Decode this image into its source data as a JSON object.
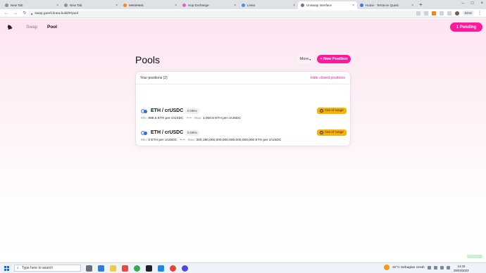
{
  "browser": {
    "tabs": [
      {
        "title": "New Tab",
        "active": false
      },
      {
        "title": "New Tab",
        "active": false
      },
      {
        "title": "MetaMask",
        "active": false
      },
      {
        "title": "Hop Exchange",
        "active": false
      },
      {
        "title": "Linea",
        "active": false
      },
      {
        "title": "Uniswap Interface",
        "active": true
      },
      {
        "title": "Home - Terracon Quest",
        "active": false
      }
    ],
    "url": "swap.goerli.linea.build/#/pool",
    "profile": "Error"
  },
  "app": {
    "nav": {
      "swap": "Swap",
      "pool": "Pool"
    },
    "pending_label": "1 Pending",
    "page_title": "Pools",
    "more_label": "More",
    "new_position_label": "+ New Position",
    "positions_header": "Your positions (2)",
    "hide_closed_label": "Hide closed positions",
    "positions": [
      {
        "pair": "ETH / crUSDC",
        "fee": "0.05%",
        "status": "Out of range",
        "min_label": "Min:",
        "min_value": "999.5 ETH per crUSDC",
        "max_label": "Max:",
        "max_value": "1,000.5 ETH per crUSDC"
      },
      {
        "pair": "ETH / crUSDC",
        "fee": "0.05%",
        "status": "Out of range",
        "min_label": "Min:",
        "min_value": "0 ETH per crUSDC",
        "max_label": "Max:",
        "max_value": "340,190,000,000,000,000,000,000,000 ETH per crUSDC"
      }
    ]
  },
  "taskbar": {
    "search_placeholder": "Type here to search",
    "weather": "31°C  Sebagian cerah",
    "time": "14:33",
    "date": "29/03/2023"
  },
  "colors": {
    "accent": "#fc1a9c",
    "warning": "#f6b20a"
  }
}
